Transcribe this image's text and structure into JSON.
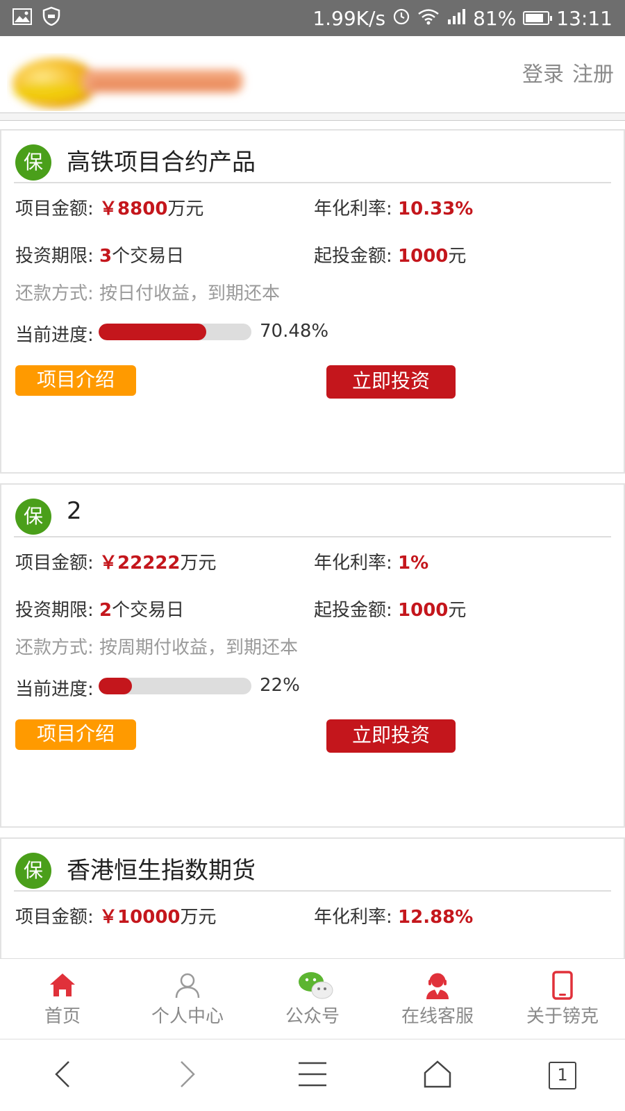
{
  "status_bar": {
    "speed": "1.99K/s",
    "battery": "81%",
    "battery_level": 0.81,
    "time": "13:11"
  },
  "header": {
    "login": "登录",
    "register": "注册"
  },
  "labels": {
    "amount": "项目金额: ",
    "rate": "年化利率: ",
    "term": "投资期限: ",
    "min": "起投金额: ",
    "progress": "当前进度:",
    "intro_button": "项目介绍",
    "invest_button": "立即投资",
    "badge": "保",
    "currency": "￥",
    "amount_unit": "万元",
    "term_unit": "个交易日",
    "min_unit": "元"
  },
  "products": [
    {
      "title": "高铁项目合约产品",
      "amount": "8800",
      "rate": "10.33%",
      "term": "3",
      "min": "1000",
      "repayment": "还款方式: 按日付收益，到期还本",
      "progress_text": "70.48%",
      "progress": 0.7048
    },
    {
      "title": "2",
      "amount": "22222",
      "rate": "1%",
      "term": "2",
      "min": "1000",
      "repayment": "还款方式: 按周期付收益，到期还本",
      "progress_text": "22%",
      "progress": 0.22
    },
    {
      "title": "香港恒生指数期货",
      "amount": "10000",
      "rate": "12.88%"
    }
  ],
  "tabs": [
    {
      "label": "首页",
      "icon": "home-icon",
      "active": true
    },
    {
      "label": "个人中心",
      "icon": "user-icon"
    },
    {
      "label": "公众号",
      "icon": "wechat-icon"
    },
    {
      "label": "在线客服",
      "icon": "customer-service-icon"
    },
    {
      "label": "关于镑克",
      "icon": "phone-icon"
    }
  ],
  "browser_nav": {
    "tab_count": "1"
  },
  "colors": {
    "accent_red": "#c4161c",
    "orange": "#ff9a00",
    "badge_green": "#4a9f1a"
  }
}
